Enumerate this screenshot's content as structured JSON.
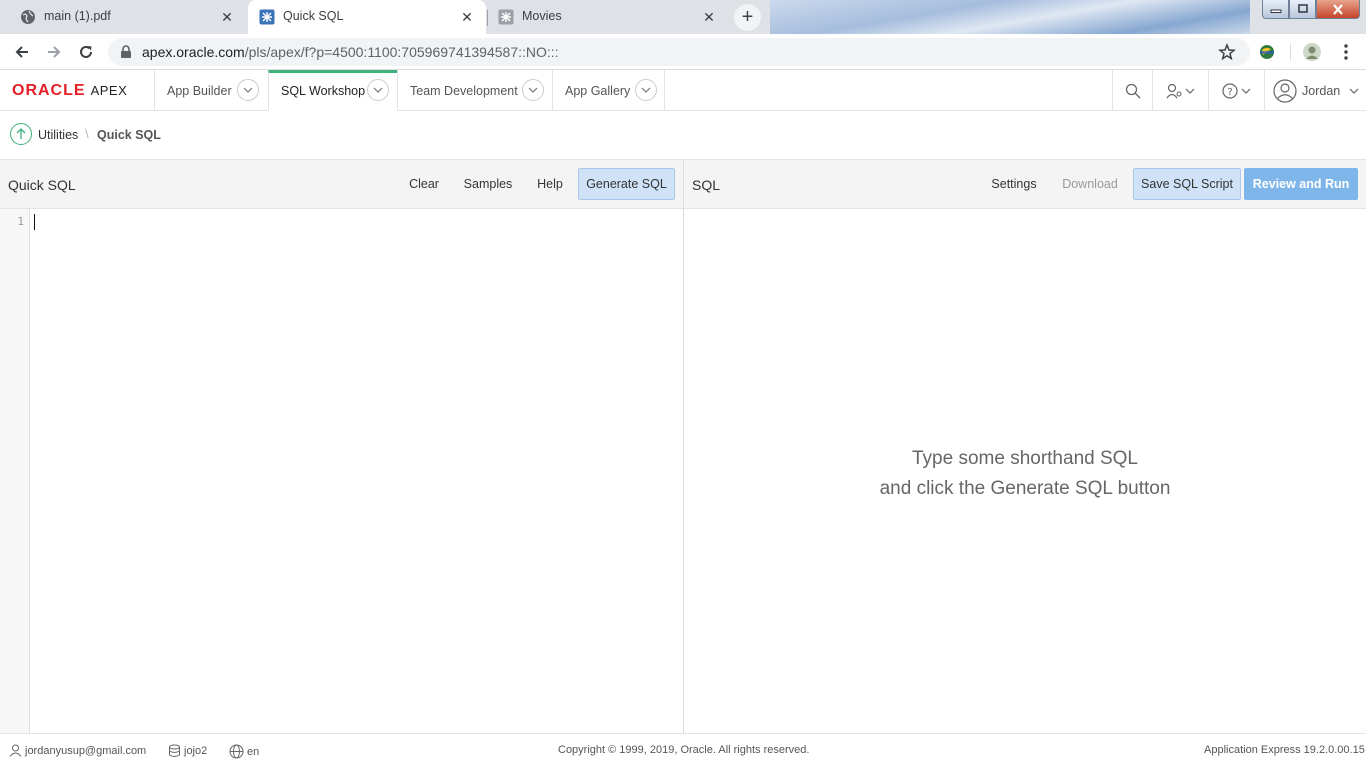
{
  "browser": {
    "tabs": [
      {
        "title": "main (1).pdf",
        "icon": "globe-icon",
        "active": false
      },
      {
        "title": "Quick SQL",
        "icon": "apex-tile-icon",
        "active": true
      },
      {
        "title": "Movies",
        "icon": "apex-tile-icon",
        "active": false
      }
    ],
    "url_host": "apex.oracle.com",
    "url_path": "/pls/apex/f?p=4500:1100:705969741394587::NO:::"
  },
  "apex": {
    "logo_oracle": "ORACLE",
    "logo_apex": "APEX",
    "nav": [
      "App Builder",
      "SQL Workshop",
      "Team Development",
      "App Gallery"
    ],
    "active_nav": "SQL Workshop",
    "user": "Jordan"
  },
  "breadcrumb": {
    "parent": "Utilities",
    "current": "Quick SQL"
  },
  "left_panel": {
    "title": "Quick SQL",
    "buttons": {
      "clear": "Clear",
      "samples": "Samples",
      "help": "Help",
      "generate": "Generate SQL"
    },
    "line_number": "1"
  },
  "right_panel": {
    "title": "SQL",
    "buttons": {
      "settings": "Settings",
      "download": "Download",
      "save": "Save SQL Script",
      "review": "Review and Run"
    },
    "empty_line1": "Type some shorthand SQL",
    "empty_line2": "and click the Generate SQL button"
  },
  "footer": {
    "email": "jordanyusup@gmail.com",
    "workspace": "jojo2",
    "language": "en",
    "copyright": "Copyright © 1999, 2019, Oracle. All rights reserved.",
    "version": "Application Express 19.2.0.00.15"
  },
  "colors": {
    "oracle_red": "#e41f26",
    "active_tab_accent": "#3fb17a",
    "primary_button": "#7fb6ea",
    "light_button": "#cfe2f8"
  }
}
